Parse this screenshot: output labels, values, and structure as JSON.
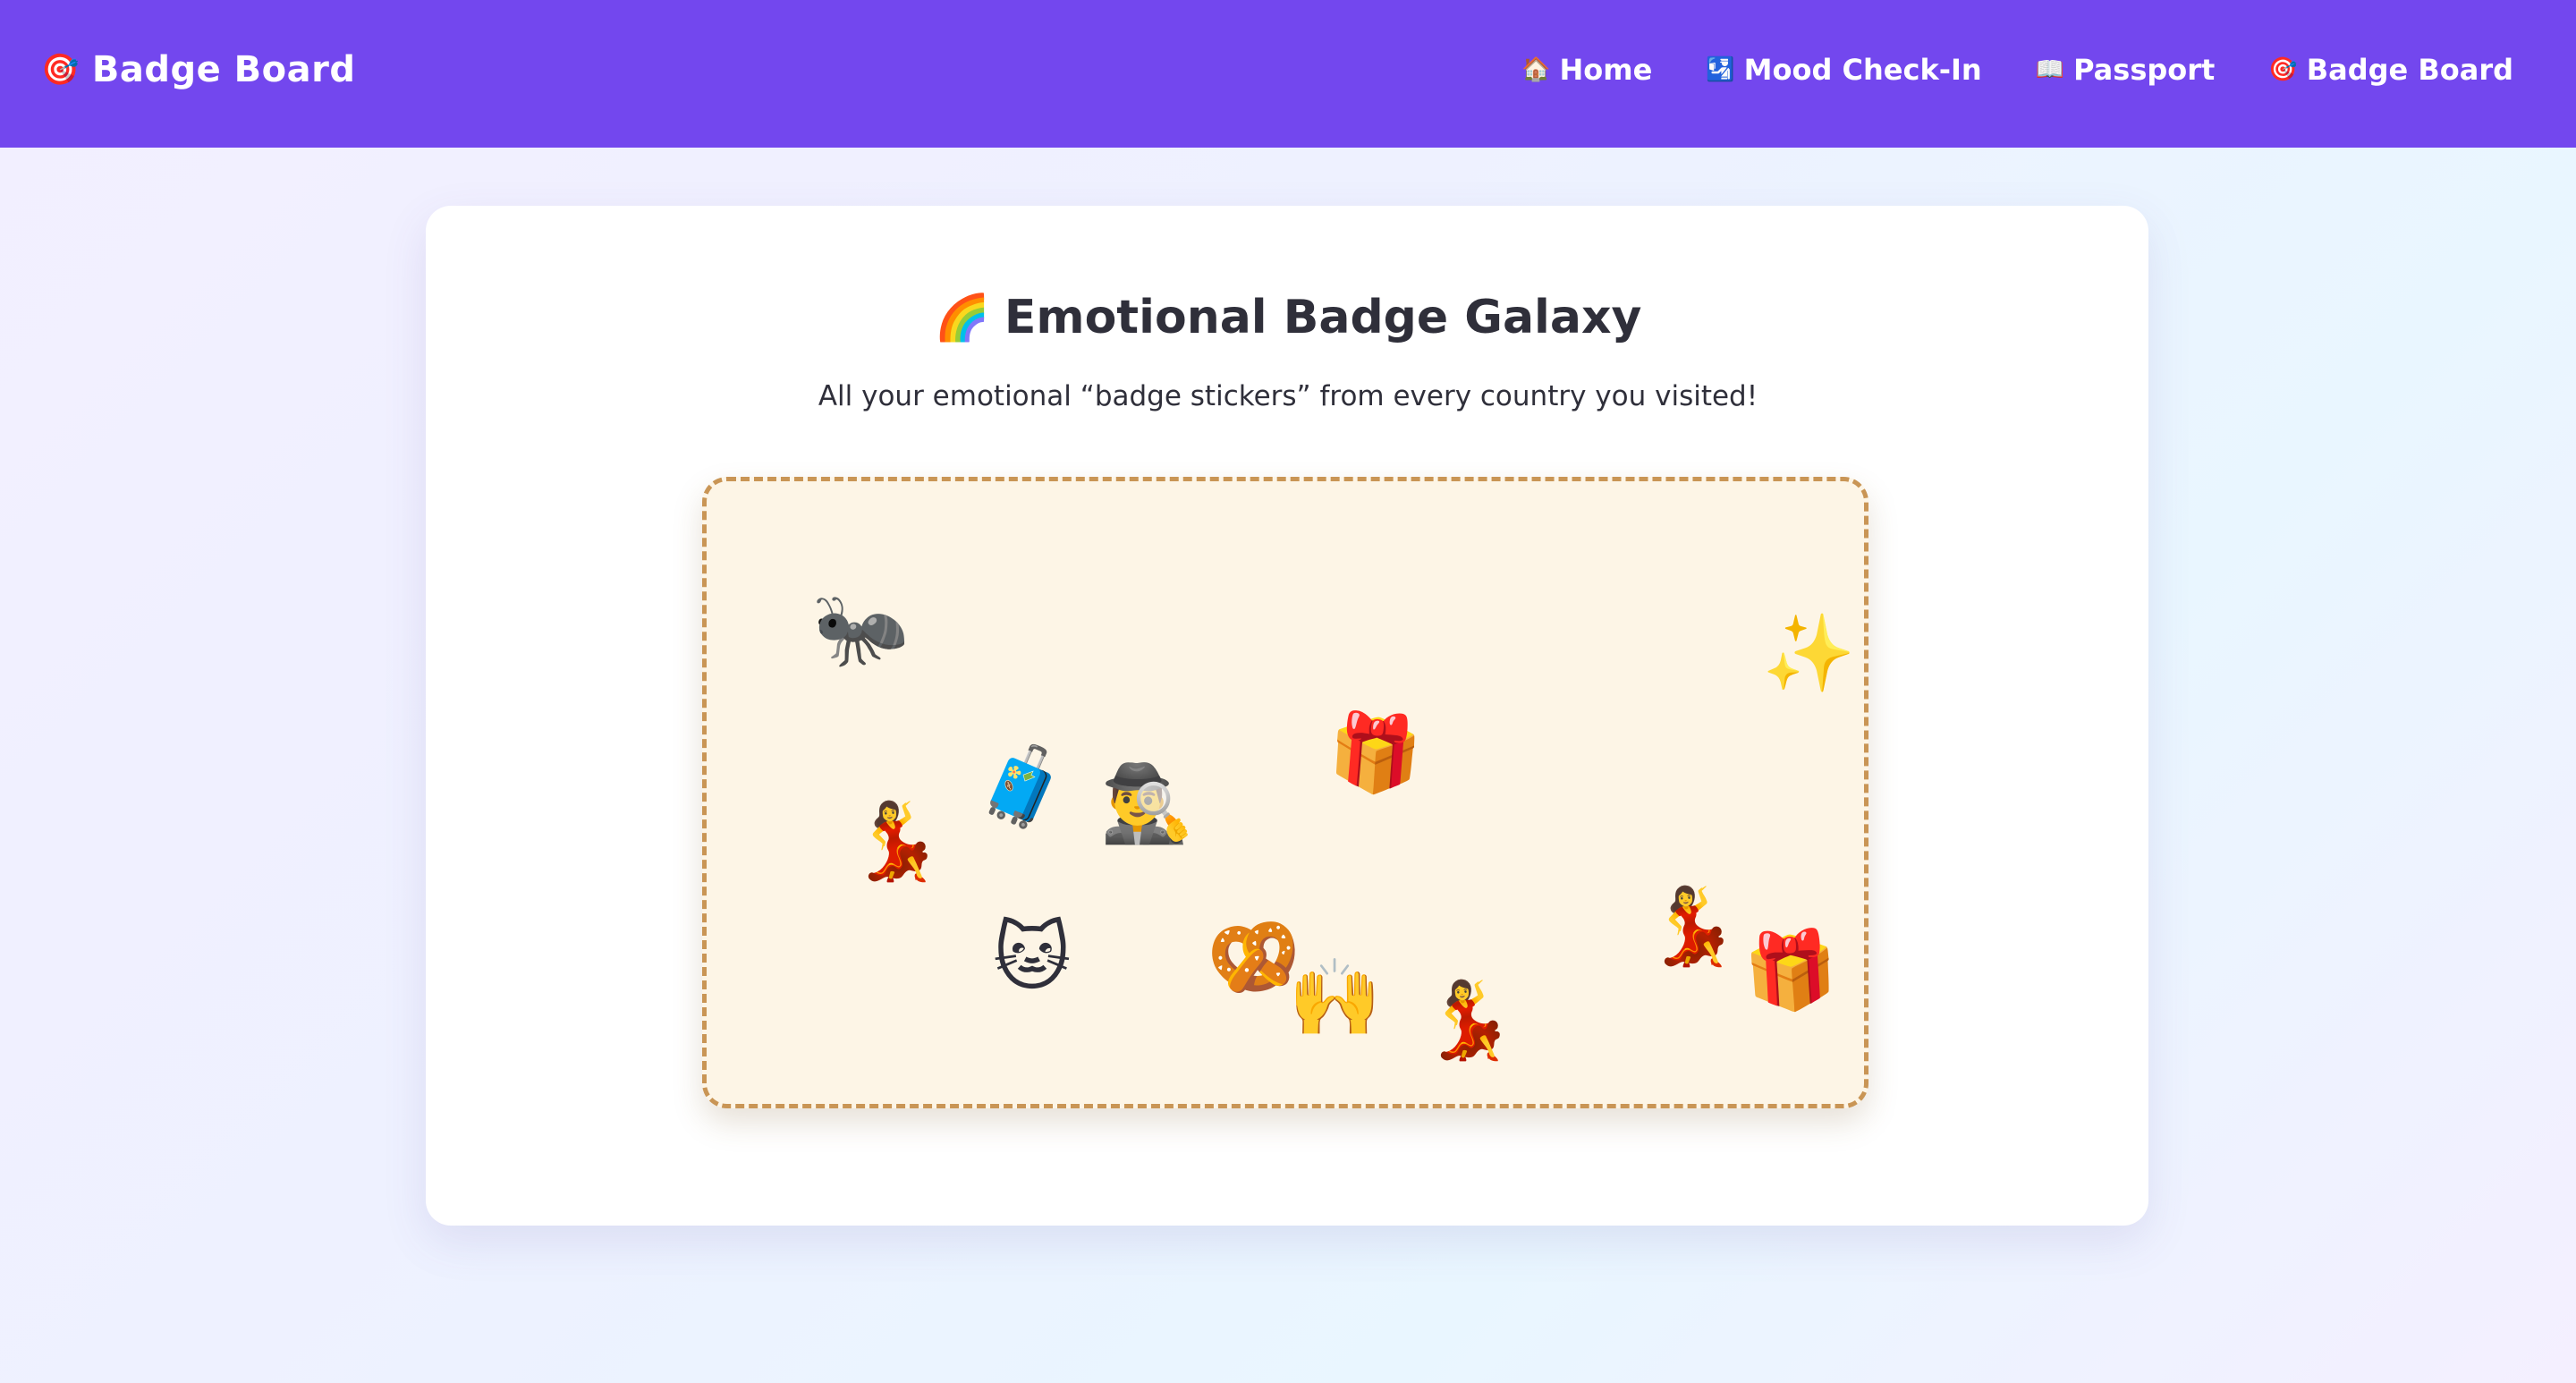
{
  "brand": {
    "icon": "🎯",
    "icon_name": "dart-target-icon",
    "title": "Badge Board"
  },
  "nav": {
    "items": [
      {
        "icon": "🏠",
        "icon_name": "house-icon",
        "label": "Home"
      },
      {
        "icon": "🛂",
        "icon_name": "passport-control-icon",
        "label": "Mood Check-In"
      },
      {
        "icon": "📖",
        "icon_name": "open-book-icon",
        "label": "Passport"
      },
      {
        "icon": "🎯",
        "icon_name": "dart-target-icon",
        "label": "Badge Board"
      }
    ]
  },
  "main": {
    "title_icon": "🌈",
    "title": "Emotional Badge Galaxy",
    "subtitle": "All your emotional “badge stickers” from every country you visited!"
  },
  "board": {
    "stickers": [
      {
        "emoji": "🐜",
        "name": "ant-sticker"
      },
      {
        "emoji": "🧳",
        "name": "luggage-sticker"
      },
      {
        "emoji": "🕵️‍♂️",
        "name": "detective-sticker"
      },
      {
        "emoji": "🎁",
        "name": "gift-sticker"
      },
      {
        "emoji": "✨",
        "name": "sparkles-sticker"
      },
      {
        "emoji": "💃",
        "name": "dancer-sticker"
      },
      {
        "emoji": "🐱",
        "name": "cat-face-sticker"
      },
      {
        "emoji": "🥨",
        "name": "pretzel-sticker"
      },
      {
        "emoji": "🙌",
        "name": "raising-hands-sticker"
      },
      {
        "emoji": "💃",
        "name": "dancer-sticker"
      },
      {
        "emoji": "💃",
        "name": "dancer-sticker"
      },
      {
        "emoji": "🎁",
        "name": "gift-sticker"
      }
    ]
  },
  "colors": {
    "topbar": "#7347ee",
    "board_background": "#fdf5e6",
    "board_border": "#c99555"
  }
}
